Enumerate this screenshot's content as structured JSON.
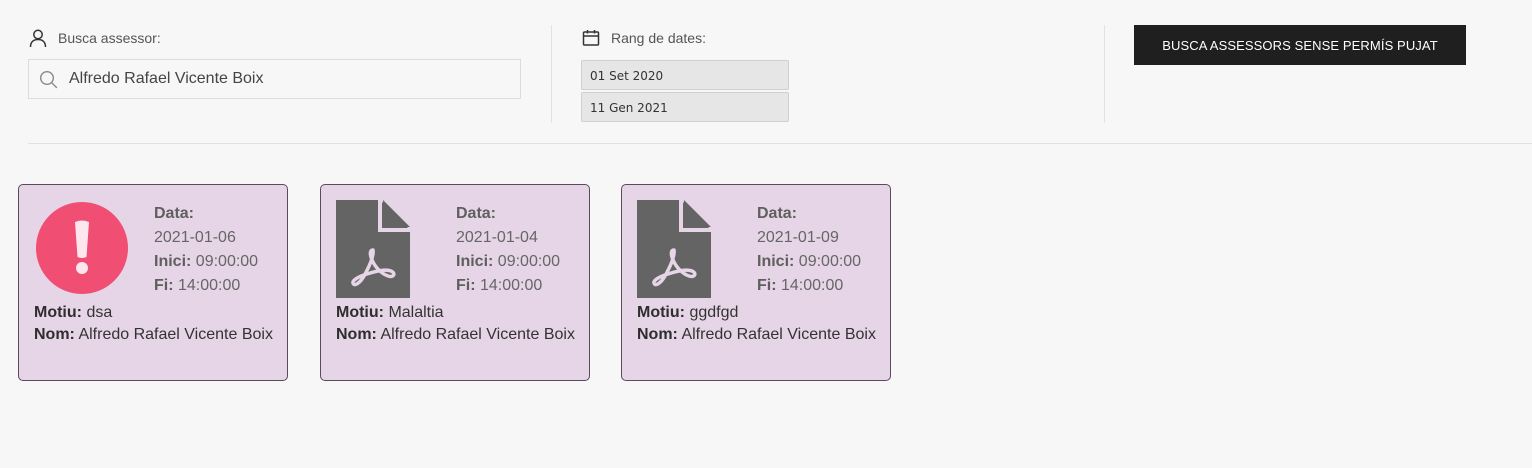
{
  "filters": {
    "advisor_label": "Busca assessor:",
    "advisor_value": "Alfredo Rafael Vicente Boix",
    "date_range_label": "Rang de dates:",
    "date_from": "01 Set 2020",
    "date_to": "11 Gen 2021",
    "action_button": "BUSCA ASSESSORS SENSE PERMÍS PUJAT"
  },
  "labels": {
    "date": "Data:",
    "start": "Inici:",
    "end": "Fi:",
    "reason": "Motiu:",
    "name": "Nom:"
  },
  "cards": [
    {
      "icon": "alert-icon",
      "date": "2021-01-06",
      "start": "09:00:00",
      "end": "14:00:00",
      "reason": "dsa",
      "name": "Alfredo Rafael Vicente Boix"
    },
    {
      "icon": "pdf-file-icon",
      "date": "2021-01-04",
      "start": "09:00:00",
      "end": "14:00:00",
      "reason": "Malaltia",
      "name": "Alfredo Rafael Vicente Boix"
    },
    {
      "icon": "pdf-file-icon",
      "date": "2021-01-09",
      "start": "09:00:00",
      "end": "14:00:00",
      "reason": "ggdfgd",
      "name": "Alfredo Rafael Vicente Boix"
    }
  ],
  "colors": {
    "card_bg": "#e6d5e6",
    "alert": "#f04e72",
    "pdf_icon": "#646464",
    "button_bg": "#1f1f1f"
  }
}
